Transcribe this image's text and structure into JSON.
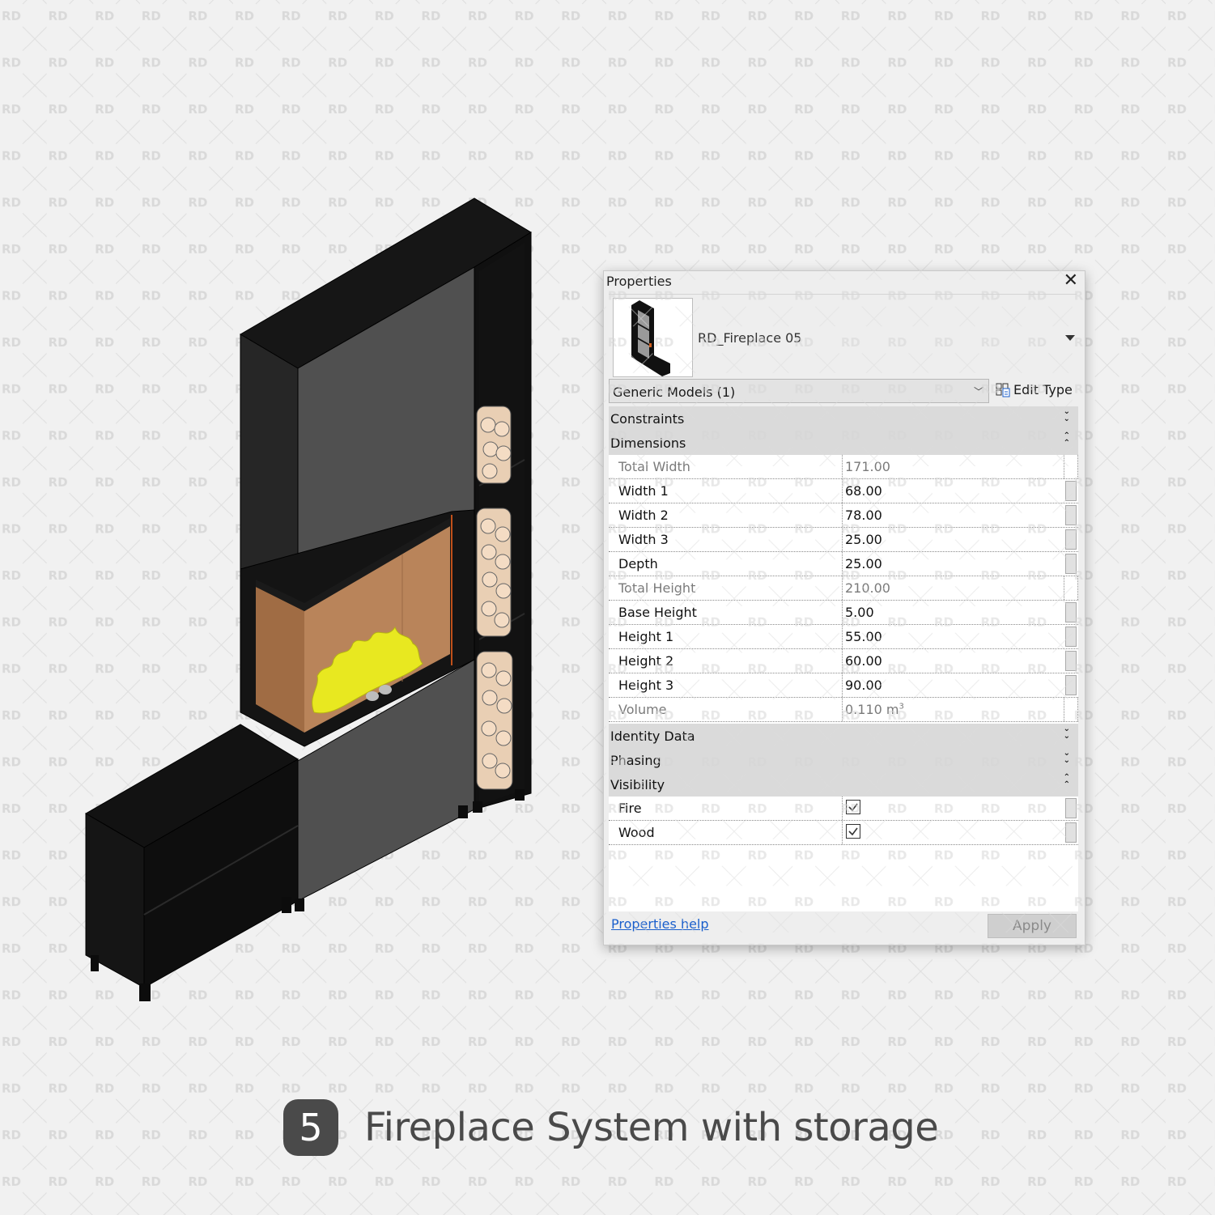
{
  "watermark": {
    "text": "RD"
  },
  "dialog": {
    "title": "Properties",
    "close_icon": "close-icon",
    "type_selector": {
      "family_type": "RD_Fireplace 05"
    },
    "category_filter": {
      "value": "Generic Models (1)"
    },
    "edit_type_label": "Edit Type",
    "groups": [
      {
        "label": "Constraints",
        "expanded": false
      },
      {
        "label": "Dimensions",
        "expanded": true,
        "rows": [
          {
            "name": "Total Width",
            "value": "171.00",
            "readonly": true
          },
          {
            "name": "Width 1",
            "value": "68.00",
            "readonly": false
          },
          {
            "name": "Width 2",
            "value": "78.00",
            "readonly": false
          },
          {
            "name": "Width 3",
            "value": "25.00",
            "readonly": false
          },
          {
            "name": "Depth",
            "value": "25.00",
            "readonly": false
          },
          {
            "name": "Total Height",
            "value": "210.00",
            "readonly": true
          },
          {
            "name": "Base Height",
            "value": "5.00",
            "readonly": false
          },
          {
            "name": "Height 1",
            "value": "55.00",
            "readonly": false
          },
          {
            "name": "Height 2",
            "value": "60.00",
            "readonly": false
          },
          {
            "name": "Height 3",
            "value": "90.00",
            "readonly": false
          },
          {
            "name": "Volume",
            "value": "0.110 m",
            "unit_sup": "3",
            "readonly": true
          }
        ]
      },
      {
        "label": "Identity Data",
        "expanded": false
      },
      {
        "label": "Phasing",
        "expanded": false
      },
      {
        "label": "Visibility",
        "expanded": true,
        "rows": [
          {
            "name": "Fire",
            "checked": true
          },
          {
            "name": "Wood",
            "checked": true
          }
        ]
      }
    ],
    "help_link": "Properties help",
    "apply_label": "Apply"
  },
  "caption": {
    "number": "5",
    "title": "Fireplace System with storage"
  },
  "colors": {
    "body_black": "#141414",
    "panel_grey": "#505050",
    "firebox_bg": "#b07a50",
    "flame": "#e6e620",
    "wood": "#f0d6bc",
    "link_blue": "#1a5fcc"
  }
}
